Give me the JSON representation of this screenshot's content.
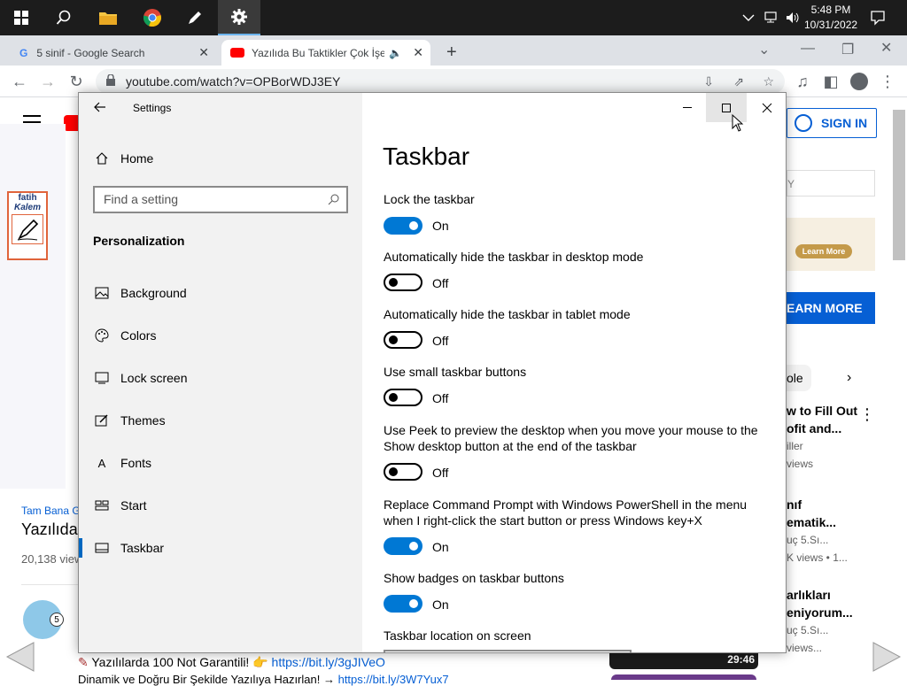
{
  "os_taskbar": {
    "clock_time": "5:48 PM",
    "clock_date": "10/31/2022"
  },
  "browser": {
    "tabs": [
      {
        "label": "5 sinif - Google Search"
      },
      {
        "label": "Yazılıda Bu Taktikler Çok İşe Y"
      }
    ],
    "url": "youtube.com/watch?v=OPBorWDJ3EY"
  },
  "youtube": {
    "sign_in": "SIGN IN",
    "search_placeholder_partial": "Y",
    "learn_more_ad": "Learn More",
    "learn_more_button": "EARN MORE",
    "chip_partial": "ole",
    "channel_partial": "Tam Bana G",
    "title_partial": "Yazılıda",
    "views_partial": "20,138 view",
    "description_line1": "Yazılılarda 100 Not Garantili! 👉",
    "description_link1": "https://bit.ly/3gJIVeO",
    "description_line2_partial": "Dinamik ve Doğru Bir Şekilde Yazılıya Hazırlan! →",
    "description_link2_partial": "https://bit.ly/3W7Yux7",
    "logo_line1": "fatih",
    "logo_line2": "Kalem",
    "avatar_badge": "5",
    "recs": [
      {
        "title1": "w to Fill Out",
        "title2": "ofit and...",
        "meta1": "iller",
        "meta2": "views"
      },
      {
        "title1": "nıf",
        "title2": "ematik...",
        "meta1": "uç 5.Sı...",
        "meta2": "K views  • 1..."
      },
      {
        "title1": "arlıkları",
        "title2": "eniyorum...",
        "meta1": "uç 5.Sı...",
        "meta2": "views..."
      }
    ],
    "thumb_duration": "29:46"
  },
  "settings": {
    "window_title": "Settings",
    "home_label": "Home",
    "search_placeholder": "Find a setting",
    "section_label": "Personalization",
    "nav_items": [
      {
        "label": "Background",
        "icon": "picture-icon"
      },
      {
        "label": "Colors",
        "icon": "palette-icon"
      },
      {
        "label": "Lock screen",
        "icon": "lock-screen-icon"
      },
      {
        "label": "Themes",
        "icon": "themes-icon"
      },
      {
        "label": "Fonts",
        "icon": "fonts-icon"
      },
      {
        "label": "Start",
        "icon": "start-icon"
      },
      {
        "label": "Taskbar",
        "icon": "taskbar-icon"
      }
    ],
    "page_title": "Taskbar",
    "options": [
      {
        "label": "Lock the taskbar",
        "state": "On"
      },
      {
        "label": "Automatically hide the taskbar in desktop mode",
        "state": "Off"
      },
      {
        "label": "Automatically hide the taskbar in tablet mode",
        "state": "Off"
      },
      {
        "label": "Use small taskbar buttons",
        "state": "Off"
      },
      {
        "label": "Use Peek to preview the desktop when you move your mouse to the Show desktop button at the end of the taskbar",
        "state": "Off"
      },
      {
        "label": "Replace Command Prompt with Windows PowerShell in the menu when I right-click the start button or press Windows key+X",
        "state": "On"
      },
      {
        "label": "Show badges on taskbar buttons",
        "state": "On"
      }
    ],
    "location_label": "Taskbar location on screen"
  },
  "colors": {
    "accent": "#0078d4",
    "youtube_blue": "#065fd4",
    "taskbar_bg": "#1c1c1c"
  }
}
